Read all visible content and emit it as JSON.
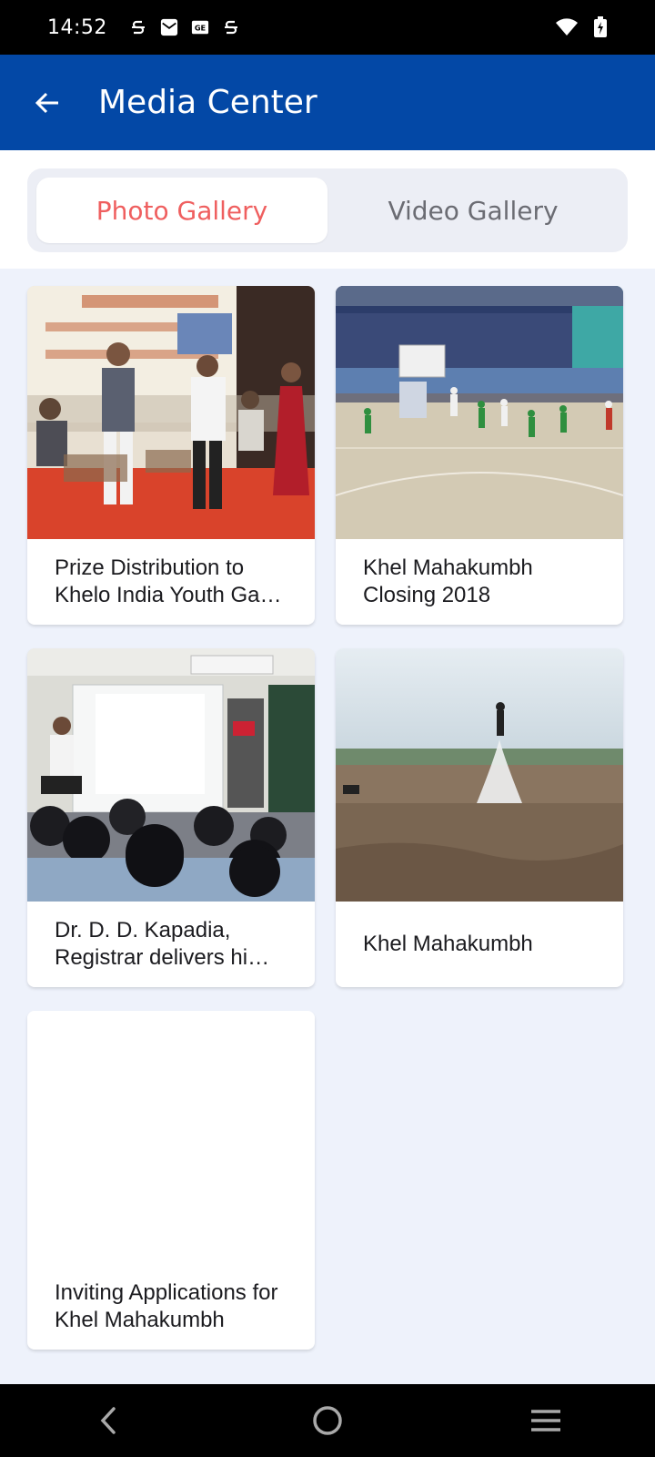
{
  "status_bar": {
    "time": "14:52",
    "left_icons": [
      "s-icon",
      "mail-icon",
      "ge-icon",
      "s-icon"
    ],
    "right_icons": [
      "wifi-icon",
      "battery-charging-icon"
    ]
  },
  "app_bar": {
    "title": "Media Center",
    "back_icon": "arrow-left-icon",
    "background": "#0348a6"
  },
  "tabs": [
    {
      "label": "Photo Gallery",
      "selected": true
    },
    {
      "label": "Video Gallery",
      "selected": false
    }
  ],
  "colors": {
    "accent": "#ef5f5f",
    "content_bg": "#eef2fb"
  },
  "gallery": [
    {
      "caption": "Prize Distribution to Khelo India Youth Ga…",
      "image": "award-ceremony-photo"
    },
    {
      "caption": "Khel Mahakumbh Closing 2018",
      "image": "basketball-court-photo"
    },
    {
      "caption": "Dr. D. D. Kapadia, Registrar delivers hi…",
      "image": "seminar-presentation-photo"
    },
    {
      "caption": "Khel Mahakumbh",
      "image": "water-jetpack-photo"
    },
    {
      "caption": "Inviting Applications for Khel Mahakumbh",
      "image": "blank-photo"
    }
  ],
  "nav_bar": {
    "buttons": [
      "back-nav-icon",
      "home-nav-icon",
      "recents-nav-icon"
    ]
  }
}
